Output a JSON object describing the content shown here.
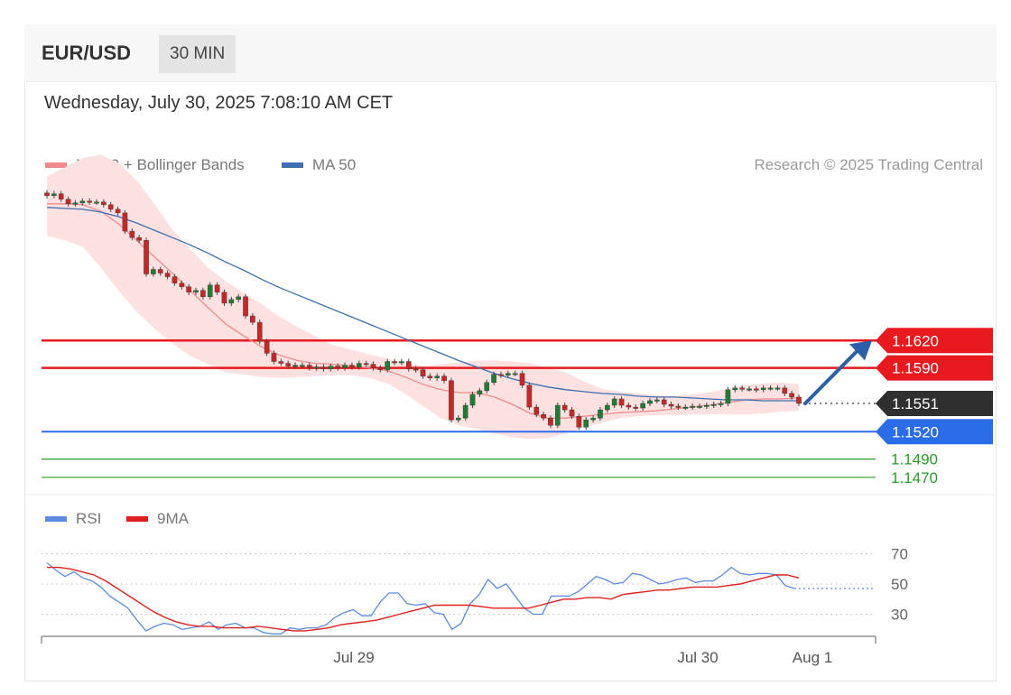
{
  "header": {
    "symbol": "EUR/USD",
    "timeframe": "30 MIN"
  },
  "timestamp": "Wednesday, July 30, 2025 7:08:10 AM CET",
  "legend": {
    "ma_bb": "MA 20 + Bollinger Bands",
    "ma50": "MA 50",
    "rsi": "RSI",
    "rsi_ma": "9MA"
  },
  "credit": "Research © 2025 Trading Central",
  "colors": {
    "resistance": "#e8191f",
    "pivot": "#2b6de8",
    "support": "#2a9d2a",
    "last": "#2f2f2f",
    "ma50": "#3c6fb0",
    "ma20": "#f08a8a",
    "band": "#fde0e0",
    "bull": "#1e7d32",
    "bear": "#c62828",
    "rsi": "#5b8ce0",
    "rsi_ma": "#e02020",
    "arrow": "#2d5fa8"
  },
  "chart_data": [
    {
      "type": "line",
      "panel": "price",
      "x_ticks": [
        "Jul 29",
        "Jul 30",
        "Aug 1"
      ],
      "levels": [
        {
          "label": "1.1620",
          "value": 1.162,
          "kind": "resistance"
        },
        {
          "label": "1.1590",
          "value": 1.159,
          "kind": "resistance"
        },
        {
          "label": "1.1551",
          "value": 1.1551,
          "kind": "last"
        },
        {
          "label": "1.1520",
          "value": 1.152,
          "kind": "pivot"
        },
        {
          "label": "1.1490",
          "value": 1.149,
          "kind": "support"
        },
        {
          "label": "1.1470",
          "value": 1.147,
          "kind": "support"
        }
      ],
      "close": [
        1.1779,
        1.1781,
        1.1775,
        1.177,
        1.1771,
        1.1773,
        1.1772,
        1.1772,
        1.1769,
        1.1764,
        1.176,
        1.174,
        1.1733,
        1.173,
        1.1693,
        1.1698,
        1.1694,
        1.169,
        1.1683,
        1.1679,
        1.1673,
        1.1675,
        1.1668,
        1.1681,
        1.1673,
        1.1661,
        1.1665,
        1.1668,
        1.1647,
        1.164,
        1.1619,
        1.1606,
        1.1597,
        1.1595,
        1.1592,
        1.1593,
        1.1593,
        1.159,
        1.1591,
        1.1589,
        1.1592,
        1.159,
        1.1593,
        1.1591,
        1.1595,
        1.1594,
        1.159,
        1.1588,
        1.1597,
        1.1596,
        1.1597,
        1.1589,
        1.1588,
        1.1581,
        1.1579,
        1.1581,
        1.1576,
        1.1533,
        1.1535,
        1.1549,
        1.1561,
        1.1565,
        1.1574,
        1.1583,
        1.1582,
        1.1584,
        1.1584,
        1.1571,
        1.1547,
        1.1539,
        1.1535,
        1.1527,
        1.1549,
        1.1544,
        1.1537,
        1.1525,
        1.1533,
        1.1535,
        1.1544,
        1.1549,
        1.1556,
        1.1549,
        1.1547,
        1.1546,
        1.1551,
        1.1554,
        1.1555,
        1.155,
        1.1548,
        1.1547,
        1.1547,
        1.1548,
        1.1548,
        1.1549,
        1.155,
        1.1551,
        1.1566,
        1.1568,
        1.1567,
        1.1567,
        1.1566,
        1.1568,
        1.1568,
        1.1568,
        1.1562,
        1.1558,
        1.1551
      ],
      "ma50": [
        1.1766,
        1.1765,
        1.1764,
        1.1761,
        1.1756,
        1.1749,
        1.1741,
        1.1733,
        1.1725,
        1.1716,
        1.1706,
        1.1697,
        1.1687,
        1.1678,
        1.167,
        1.1662,
        1.1654,
        1.1646,
        1.1638,
        1.163,
        1.1622,
        1.1614,
        1.1606,
        1.1598,
        1.1591,
        1.1584,
        1.1578,
        1.1573,
        1.1569,
        1.1566,
        1.1564,
        1.1562,
        1.1561,
        1.1559,
        1.1558,
        1.1558,
        1.1557,
        1.1556,
        1.1555,
        1.1555,
        1.1554,
        1.1554,
        1.1554
      ],
      "ma20": [
        1.177,
        1.177,
        1.1769,
        1.1762,
        1.1748,
        1.173,
        1.1712,
        1.1694,
        1.1675,
        1.1656,
        1.1638,
        1.1625,
        1.1613,
        1.1604,
        1.1598,
        1.1595,
        1.1594,
        1.1592,
        1.159,
        1.1587,
        1.158,
        1.1572,
        1.1566,
        1.1563,
        1.1563,
        1.1558,
        1.155,
        1.154,
        1.1535,
        1.1535,
        1.1537,
        1.1539,
        1.1541,
        1.1542,
        1.1543,
        1.1545,
        1.1547,
        1.1549,
        1.1552,
        1.1555,
        1.1556,
        1.1556,
        1.1557
      ],
      "bb_upper": [
        1.18,
        1.181,
        1.182,
        1.1824,
        1.1815,
        1.1796,
        1.177,
        1.1742,
        1.172,
        1.17,
        1.1685,
        1.1672,
        1.166,
        1.1646,
        1.1635,
        1.1625,
        1.1615,
        1.161,
        1.1605,
        1.16,
        1.1596,
        1.1592,
        1.1594,
        1.1596,
        1.1598,
        1.1598,
        1.1597,
        1.1595,
        1.159,
        1.1585,
        1.1575,
        1.1567,
        1.1564,
        1.1562,
        1.156,
        1.1559,
        1.1561,
        1.1563,
        1.1567,
        1.1571,
        1.1573,
        1.1574,
        1.1572
      ],
      "bb_lower": [
        1.1735,
        1.173,
        1.1723,
        1.17,
        1.1675,
        1.1652,
        1.1633,
        1.1617,
        1.1603,
        1.1594,
        1.1585,
        1.1583,
        1.158,
        1.1579,
        1.158,
        1.1581,
        1.1582,
        1.1582,
        1.1579,
        1.1573,
        1.1562,
        1.1548,
        1.1535,
        1.1527,
        1.1523,
        1.1518,
        1.1514,
        1.1512,
        1.1513,
        1.1518,
        1.1524,
        1.153,
        1.1535,
        1.1537,
        1.1538,
        1.1538,
        1.1539,
        1.1539,
        1.1539,
        1.1539,
        1.154,
        1.1542,
        1.1543
      ],
      "forecast": {
        "from": 1.1551,
        "to": 1.162
      }
    },
    {
      "type": "line",
      "panel": "rsi",
      "y_ticks": [
        70,
        50,
        30
      ],
      "ylim": [
        10,
        80
      ],
      "series": [
        {
          "name": "RSI",
          "values": [
            64,
            59,
            55,
            58,
            54,
            52,
            48,
            42,
            38,
            34,
            26,
            19,
            22,
            24,
            23,
            20,
            21,
            22,
            25,
            20,
            23,
            24,
            21,
            21,
            18,
            17,
            17,
            21,
            20,
            21,
            21,
            23,
            28,
            31,
            33,
            29,
            29,
            38,
            44,
            44,
            37,
            36,
            37,
            31,
            30,
            20,
            24,
            37,
            43,
            53,
            47,
            50,
            42,
            34,
            30,
            30,
            42,
            42,
            42,
            45,
            50,
            55,
            53,
            50,
            51,
            57,
            56,
            53,
            50,
            51,
            53,
            54,
            51,
            52,
            52,
            56,
            61,
            57,
            56,
            57,
            57,
            56,
            49,
            47
          ]
        },
        {
          "name": "9MA",
          "values": [
            61,
            61,
            60,
            58,
            56,
            52,
            47,
            42,
            37,
            32,
            28,
            25,
            23,
            22,
            22,
            21,
            21,
            21,
            22,
            21,
            20,
            19,
            19,
            20,
            21,
            23,
            24,
            25,
            26,
            28,
            30,
            32,
            34,
            36,
            36,
            36,
            36,
            35,
            34,
            34,
            34,
            34,
            36,
            38,
            40,
            40,
            41,
            41,
            40,
            43,
            44,
            45,
            46,
            46,
            47,
            48,
            48,
            48,
            49,
            50,
            52,
            54,
            56,
            56,
            54
          ]
        }
      ]
    }
  ]
}
